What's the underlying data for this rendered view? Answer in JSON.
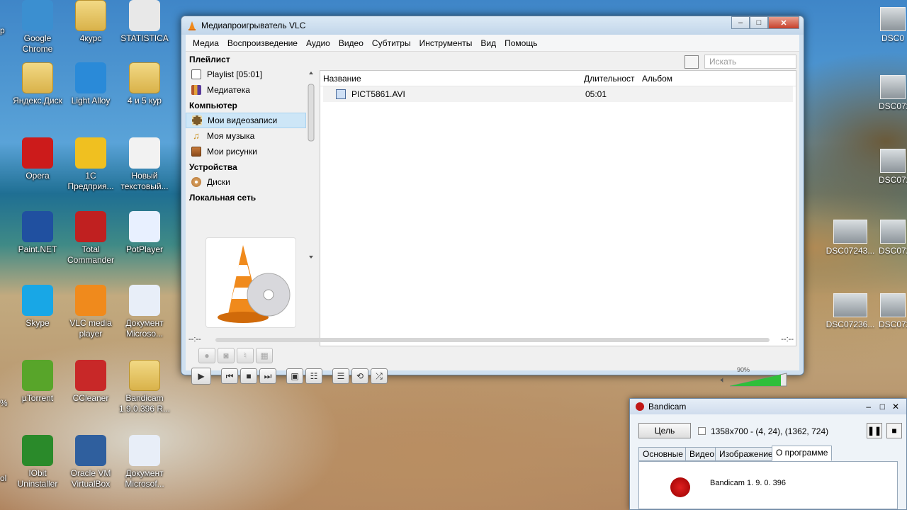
{
  "desktop": {
    "icons": [
      {
        "label": "Google\nChrome",
        "icon": "chrome-icon"
      },
      {
        "label": "4курс",
        "icon": "folder-icon"
      },
      {
        "label": "STATISTICA",
        "icon": "statistica-icon"
      },
      {
        "label": "Яндекс.Диск",
        "icon": "folder-icon"
      },
      {
        "label": "Light Alloy",
        "icon": "light-alloy-icon"
      },
      {
        "label": "4 и 5 кур",
        "icon": "folder-icon"
      },
      {
        "label": "Opera",
        "icon": "opera-icon"
      },
      {
        "label": "1С\nПредприя...",
        "icon": "1c-icon"
      },
      {
        "label": "Новый\nтекстовый...",
        "icon": "txt-icon"
      },
      {
        "label": "Paint.NET",
        "icon": "paintnet-icon"
      },
      {
        "label": "Total\nCommander",
        "icon": "total-commander-icon"
      },
      {
        "label": "PotPlayer",
        "icon": "potplayer-icon"
      },
      {
        "label": "Skype",
        "icon": "skype-icon"
      },
      {
        "label": "VLC media\nplayer",
        "icon": "vlc-icon"
      },
      {
        "label": "Документ\nMicroso...",
        "icon": "word-icon"
      },
      {
        "label": "µTorrent",
        "icon": "utorrent-icon"
      },
      {
        "label": "CCleaner",
        "icon": "ccleaner-icon"
      },
      {
        "label": "Bandicam\n1.9.0.396 R...",
        "icon": "folder-icon"
      },
      {
        "label": "IObit\nUninstaller",
        "icon": "iobit-icon"
      },
      {
        "label": "Oracle VM\nVirtualBox",
        "icon": "virtualbox-icon"
      },
      {
        "label": "Документ\nMicrosof...",
        "icon": "word-icon"
      }
    ],
    "right_thumbs": [
      "DSC0",
      "DSC072",
      "DSC072",
      "DSC07243...",
      "DSC072",
      "DSC07236...",
      "DSC072"
    ],
    "left_edge": {
      "a": "p",
      "b": "%",
      "c": "ol"
    }
  },
  "vlc": {
    "title": "Медиапроигрыватель VLC",
    "window_buttons": {
      "min": "–",
      "max": "□",
      "close": "✕"
    },
    "menu": [
      "Медиа",
      "Воспроизведение",
      "Аудио",
      "Видео",
      "Субтитры",
      "Инструменты",
      "Вид",
      "Помощь"
    ],
    "sidebar": {
      "playlist_header": "Плейлист",
      "playlist_items": [
        {
          "label": "Playlist [05:01]"
        },
        {
          "label": "Медиатека"
        }
      ],
      "computer_header": "Компьютер",
      "computer_items": [
        {
          "label": "Мои видеозаписи"
        },
        {
          "label": "Моя музыка"
        },
        {
          "label": "Мои рисунки"
        }
      ],
      "devices_header": "Устройства",
      "devices_items": [
        {
          "label": "Диски"
        }
      ],
      "lan_header": "Локальная сеть"
    },
    "search_placeholder": "Искать",
    "columns": {
      "name": "Название",
      "duration": "Длительност",
      "album": "Альбом"
    },
    "rows": [
      {
        "name": "PICT5861.AVI",
        "duration": "05:01"
      }
    ],
    "time_left": "--:--",
    "time_right": "--:--",
    "volume": {
      "label": "90%",
      "level": 0.9
    }
  },
  "bandicam": {
    "title": "Bandicam",
    "target_button": "Цель",
    "region": "1358x700 - (4, 24), (1362, 724)",
    "tabs": [
      "Основные",
      "Видео",
      "Изображение",
      "О программе"
    ],
    "version": "Bandicam 1. 9. 0. 396"
  }
}
